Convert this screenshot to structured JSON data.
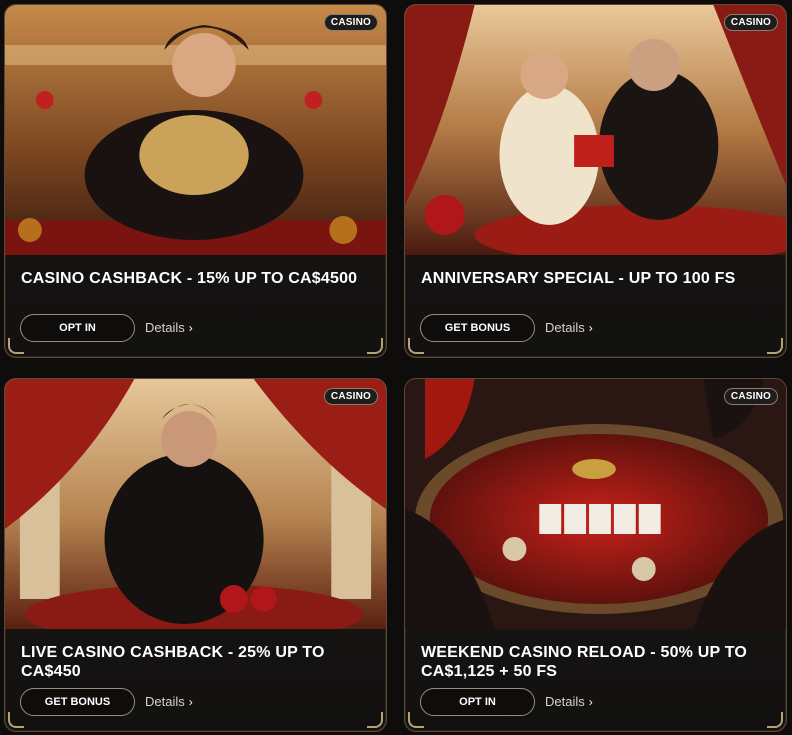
{
  "cards": [
    {
      "badge": "CASINO",
      "title": "CASINO CASHBACK - 15% UP TO CA$4500",
      "button": "OPT IN",
      "details": "Details",
      "image": "flamenco-woman-at-table"
    },
    {
      "badge": "CASINO",
      "title": "ANNIVERSARY SPECIAL - UP TO 100 FS",
      "button": "GET BONUS",
      "details": "Details",
      "image": "couple-with-gift"
    },
    {
      "badge": "CASINO",
      "title": "LIVE CASINO CASHBACK - 25% UP TO CA$450",
      "button": "GET BONUS",
      "details": "Details",
      "image": "matador-with-roses"
    },
    {
      "badge": "CASINO",
      "title": "WEEKEND CASINO RELOAD - 50% UP TO CA$1,125 + 50 FS",
      "button": "OPT IN",
      "details": "Details",
      "image": "card-table-players"
    }
  ],
  "colors": {
    "background": "#0f0d0c",
    "card_border": "#5a4a36",
    "ornament_gold": "#b8a078",
    "button_border": "#9a8c7a"
  }
}
